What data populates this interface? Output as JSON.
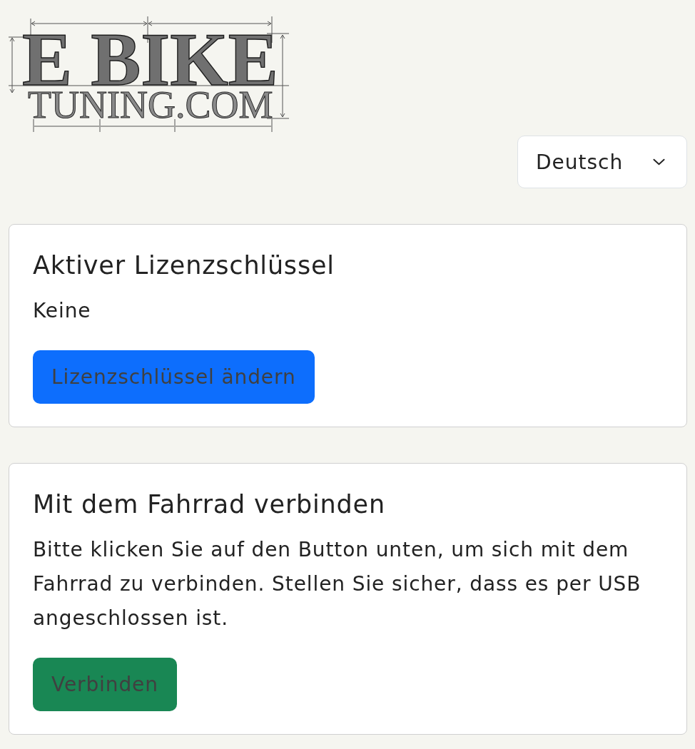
{
  "logo": {
    "line_1": "E BIKE",
    "line_2": "TUNING.COM"
  },
  "language_select": {
    "value": "Deutsch"
  },
  "cards": [
    {
      "title": "Aktiver Lizenzschlüssel",
      "text": "Keine",
      "button": {
        "label": "Lizenzschlüssel ändern",
        "kind": "primary"
      }
    },
    {
      "title": "Mit dem Fahrrad verbinden",
      "text": "Bitte klicken Sie auf den Button unten, um sich mit dem Fahrrad zu verbinden. Stellen Sie sicher, dass es per USB angeschlossen ist.",
      "button": {
        "label": "Verbinden",
        "kind": "success"
      }
    }
  ]
}
